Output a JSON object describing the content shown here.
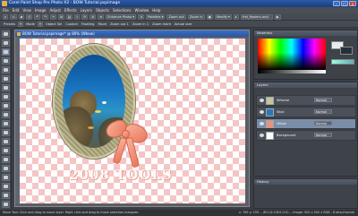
{
  "window": {
    "title": "Corel Paint Shop Pro Photo X2 - BOW Tutorial.pspimage"
  },
  "menu": [
    "File",
    "Edit",
    "View",
    "Image",
    "Adjust",
    "Effects",
    "Layers",
    "Objects",
    "Selections",
    "Window",
    "Help"
  ],
  "toolbar": {
    "enhance_photo": "Enhance Photo",
    "palettes": "Palettes",
    "zoom_out": "Zoom out",
    "zoom_in": "Zoom in",
    "modify": "Modify",
    "search_text": "frst_fiowers-and-"
  },
  "tool_options": {
    "presets": "Presets",
    "mode": "Mode",
    "object_sel": "Object Sel",
    "custom": "Custom",
    "floating": "Floating",
    "move": "Move",
    "zoom_out_1": "Zoom out 1",
    "zoom_in_1": "Zoom in 1",
    "zoom_more": "Zoom more",
    "actual_size": "Actual size"
  },
  "document": {
    "title": "BOW Tutorial.pspimage* @ 80% (Wbow)"
  },
  "canvas": {
    "watermark": "2008 TOOLS"
  },
  "materials_panel": {
    "title": "Materials"
  },
  "layers_panel": {
    "title": "Layers",
    "rows": [
      {
        "name": "Wframe",
        "blend": "Normal",
        "visible": true,
        "selected": false
      },
      {
        "name": "Wpic",
        "blend": "Normal",
        "visible": true,
        "selected": false
      },
      {
        "name": "Wbow",
        "blend": "Normal",
        "visible": true,
        "selected": true
      },
      {
        "name": "Background",
        "blend": "Normal",
        "visible": true,
        "selected": false
      }
    ]
  },
  "history_panel": {
    "title": "History"
  },
  "status": {
    "left": "Move Tool: Click and drag to move layer. Right click and drag to move selection marquee.",
    "right": "x: 765 y: 159 -- (R:0,G:0,B:0,O:0) -- Image: 500 x 500 x RGB - 8 bits/channel"
  },
  "colors": {
    "accent": "#2a5aa8",
    "canvas_check": "#f4c6c6",
    "bow": "#ef8f74",
    "layer_selected": "#7b8ea8"
  }
}
